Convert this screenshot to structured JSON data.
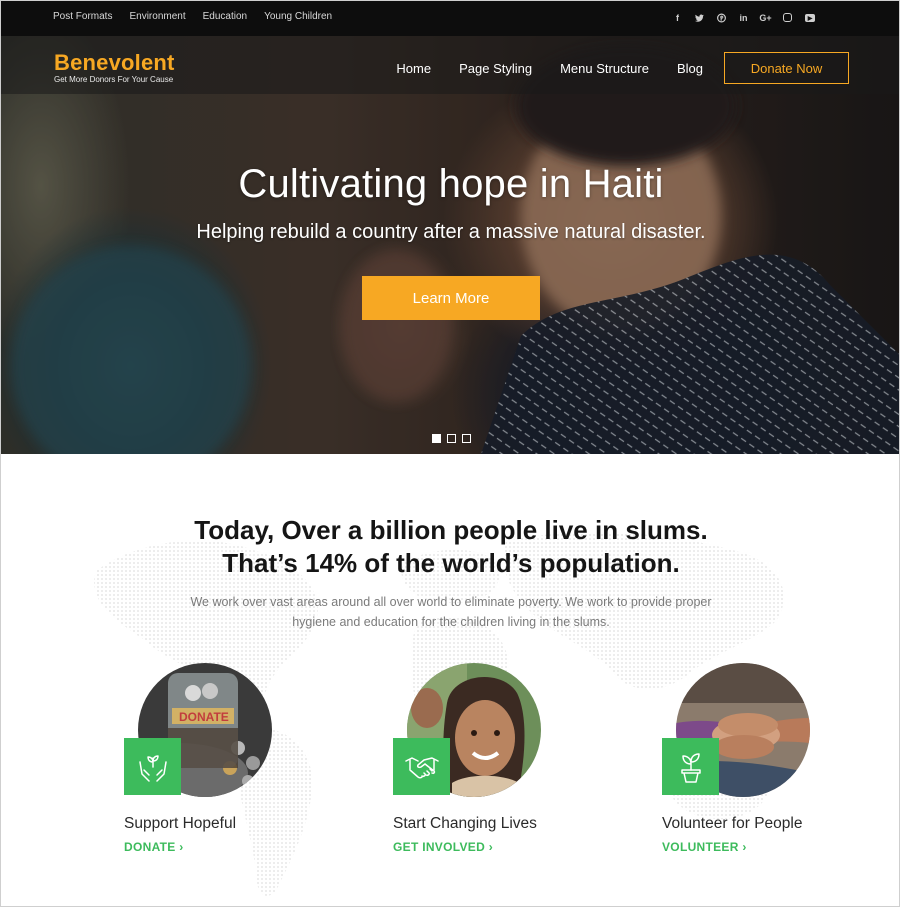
{
  "topbar": {
    "links": [
      "Post Formats",
      "Environment",
      "Education",
      "Young Children"
    ],
    "socials": [
      {
        "icon": "facebook-icon",
        "glyph": "f"
      },
      {
        "icon": "twitter-icon",
        "glyph": "t"
      },
      {
        "icon": "pinterest-icon",
        "glyph": "p"
      },
      {
        "icon": "linkedin-icon",
        "glyph": "in"
      },
      {
        "icon": "google-plus-icon",
        "glyph": "G+"
      },
      {
        "icon": "instagram-icon",
        "glyph": ""
      },
      {
        "icon": "youtube-icon",
        "glyph": "▶"
      }
    ]
  },
  "header": {
    "logo": "Benevolent",
    "tagline": "Get More Donors For Your Cause",
    "menu": [
      "Home",
      "Page Styling",
      "Menu Structure",
      "Blog"
    ],
    "donate_label": "Donate Now"
  },
  "hero": {
    "title": "Cultivating hope in Haiti",
    "subtitle": "Helping rebuild a country after a massive natural disaster.",
    "button_label": "Learn More",
    "slides": 3,
    "active_slide": 1
  },
  "intro": {
    "headline_line1": "Today, Over a billion people live in slums.",
    "headline_line2": "That’s 14% of the world’s population.",
    "text": "We work over vast areas around all over world to eliminate poverty. We work to provide proper hygiene and education for the children living in the slums."
  },
  "features": [
    {
      "title": "Support Hopeful",
      "link": "DONATE",
      "icon": "hands-plant-icon"
    },
    {
      "title": "Start Changing Lives",
      "link": "GET INVOLVED",
      "icon": "handshake-icon"
    },
    {
      "title": "Volunteer for People",
      "link": "VOLUNTEER",
      "icon": "potted-plant-icon"
    }
  ],
  "colors": {
    "accent": "#f7a823",
    "green": "#3dbb5c",
    "topbar": "#0d0d0d"
  }
}
